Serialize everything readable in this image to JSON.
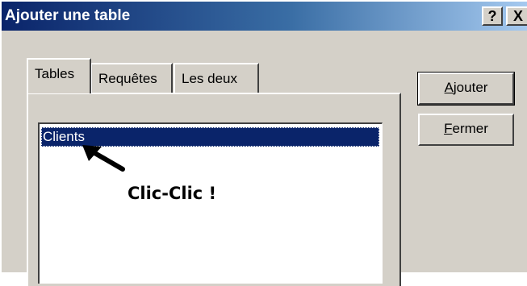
{
  "window": {
    "title": "Ajouter une table",
    "help_label": "?",
    "close_label": "X"
  },
  "tabs": [
    {
      "label": "Tables",
      "active": true
    },
    {
      "label": "Requêtes",
      "active": false
    },
    {
      "label": "Les deux",
      "active": false
    }
  ],
  "list": {
    "items": [
      "Clients"
    ],
    "selected": "Clients"
  },
  "buttons": {
    "ajouter": {
      "mnemonic": "A",
      "rest": "jouter"
    },
    "fermer": {
      "mnemonic": "F",
      "rest": "ermer"
    }
  },
  "annotation": {
    "text": "Clic-Clic !",
    "icon": "arrow-icon"
  },
  "colors": {
    "titlebar_start": "#0a246a",
    "titlebar_end": "#a6caf0",
    "face": "#d4d0c8",
    "selection": "#0a246a"
  }
}
